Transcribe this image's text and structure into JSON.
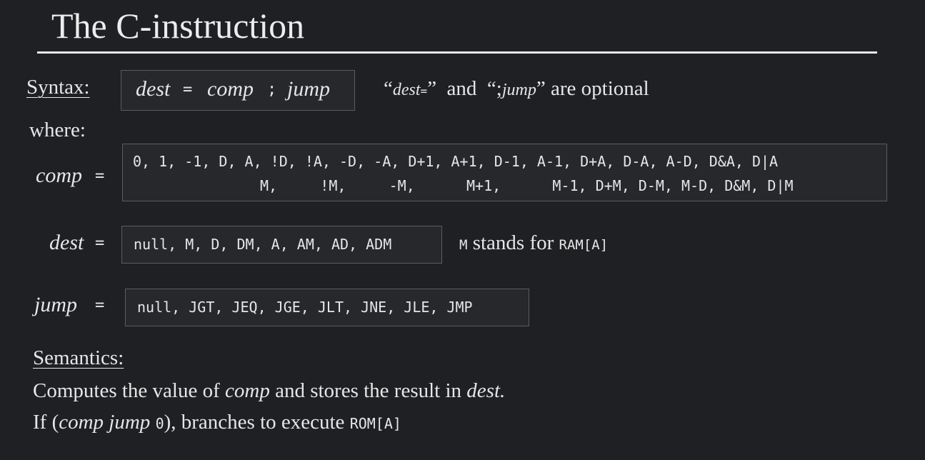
{
  "title": "The C-instruction",
  "syntax": {
    "label": "Syntax:",
    "dest": "dest",
    "eq": "=",
    "comp": "comp",
    "semi": ";",
    "jump": "jump",
    "note_open_quote": "“",
    "note_dest": "dest",
    "note_eq": "=",
    "note_close_quote_and": "”  and  “;",
    "note_jump": "jump",
    "note_rest": "” are optional"
  },
  "where_label": "where:",
  "comp": {
    "label": "comp",
    "eq": "=",
    "line1": "0, 1, -1, D, A, !D, !A, -D, -A, D+1, A+1, D-1, A-1, D+A, D-A, A-D, D&A, D|A",
    "line2": "M,     !M,     -M,      M+1,      M-1, D+M, D-M, M-D, D&M, D|M"
  },
  "dest": {
    "label": "dest",
    "eq": "=",
    "values": "null, M, D, DM, A, AM, AD, ADM",
    "note_m": "M",
    "note_text": " stands for ",
    "note_ram": "RAM[A]"
  },
  "jump": {
    "label": "jump",
    "eq": "=",
    "values": "null, JGT, JEQ, JGE, JLT, JNE, JLE, JMP"
  },
  "semantics": {
    "label": "Semantics:",
    "l1_a": "Computes the value of ",
    "l1_comp": "comp",
    "l1_b": " and stores the result in ",
    "l1_dest": "dest.",
    "l2_a": "If (",
    "l2_comp_jump": "comp jump",
    "l2_zero": "0",
    "l2_b": "), branches to execute ",
    "l2_rom": "ROM[A]"
  }
}
